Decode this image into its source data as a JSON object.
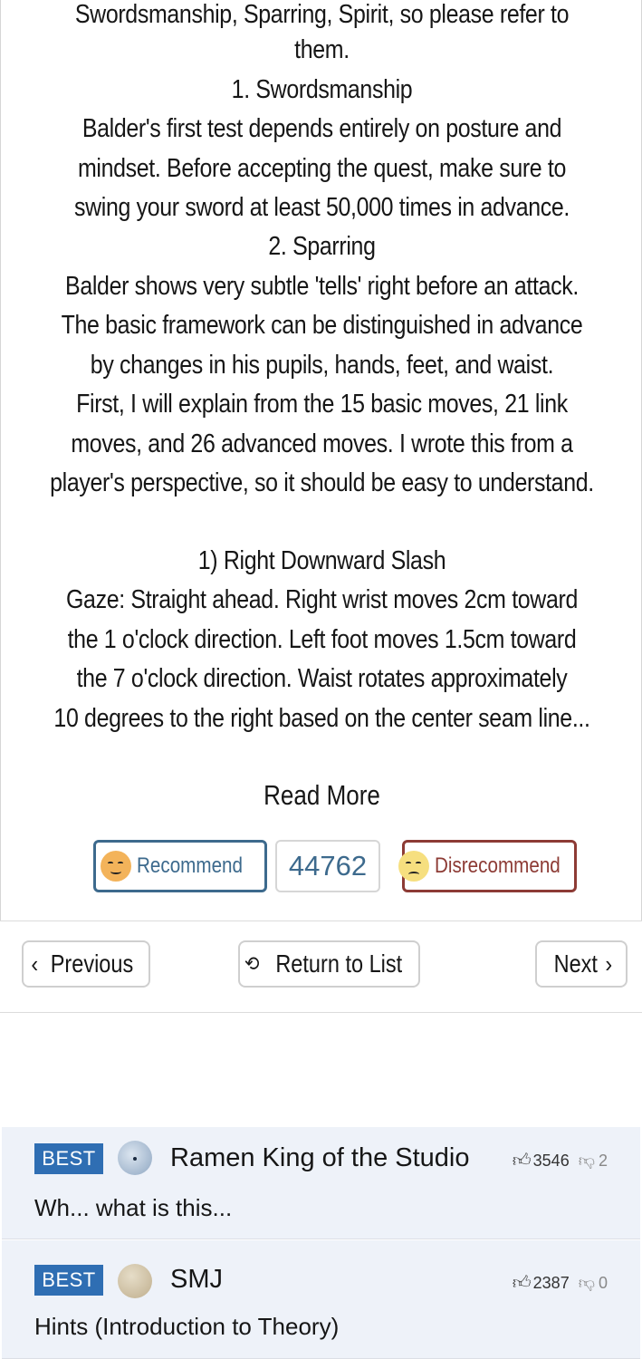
{
  "article": {
    "lines": [
      "Swordsmanship, Sparring, Spirit, so please refer to",
      "them.",
      "1. Swordsmanship",
      "Balder's first test depends entirely on posture and",
      "mindset. Before accepting the quest, make sure to",
      "swing your sword at least 50,000 times in advance.",
      "2. Sparring",
      "Balder shows very subtle 'tells' right before an attack.",
      "The basic framework can be distinguished in advance",
      "by changes in his pupils, hands, feet, and waist.",
      "First, I will explain from the 15 basic moves, 21 link",
      "moves, and 26 advanced moves. I wrote this from a",
      "player's perspective, so it should be easy to understand.",
      "1) Right Downward Slash",
      "Gaze: Straight ahead. Right wrist moves 2cm toward",
      "the 1 o'clock direction. Left foot moves 1.5cm toward",
      "the 7 o'clock direction. Waist rotates approximately",
      "10 degrees to the right based on the center seam line..."
    ],
    "read_more": "Read More"
  },
  "recommend": {
    "recommend_label": "Recommend",
    "count": "44762",
    "disrecommend_label": "Disrecommend"
  },
  "nav": {
    "previous": "Previous",
    "return_to_list": "Return to List",
    "next": "Next"
  },
  "comments": [
    {
      "badge": "BEST",
      "nickname": "Ramen King of the Studio",
      "likes": "3546",
      "dislikes": "2",
      "text": "Wh... what is this..."
    },
    {
      "badge": "BEST",
      "nickname": "SMJ",
      "likes": "2387",
      "dislikes": "0",
      "text": "Hints (Introduction to Theory)"
    }
  ],
  "colors": {
    "recommend": "#3d6a8d",
    "disrecommend": "#8d3b35",
    "best_badge": "#2f6eb3",
    "comment_bg": "#eef2f9"
  }
}
